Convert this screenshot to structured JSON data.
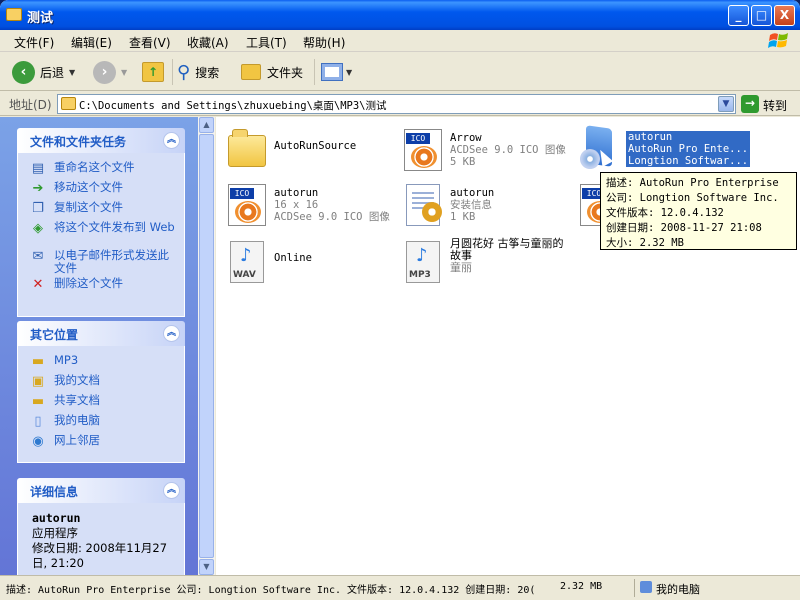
{
  "window": {
    "title": "测试"
  },
  "title_buttons": {
    "minimize": "_",
    "maximize": "□",
    "close": "X"
  },
  "menu": [
    "文件(F)",
    "编辑(E)",
    "查看(V)",
    "收藏(A)",
    "工具(T)",
    "帮助(H)"
  ],
  "toolbar": {
    "back": "后退",
    "search": "搜索",
    "folders": "文件夹"
  },
  "address": {
    "label": "地址(D)",
    "path": "C:\\Documents and Settings\\zhuxuebing\\桌面\\MP3\\测试",
    "go": "转到"
  },
  "left_panels": {
    "tasks": {
      "title": "文件和文件夹任务",
      "items": [
        "重命名这个文件",
        "移动这个文件",
        "复制这个文件",
        "将这个文件发布到 Web",
        "以电子邮件形式发送此文件",
        "删除这个文件"
      ]
    },
    "other_places": {
      "title": "其它位置",
      "items": [
        "MP3",
        "我的文档",
        "共享文档",
        "我的电脑",
        "网上邻居"
      ]
    },
    "details": {
      "title": "详细信息",
      "name": "autorun",
      "type": "应用程序",
      "modified": "修改日期: 2008年11月27日, 21:20"
    }
  },
  "files": [
    {
      "name": "AutoRunSource",
      "line2": "",
      "line3": "",
      "icon": "folder-icon"
    },
    {
      "name": "Arrow",
      "line2": "ACDSee 9.0 ICO 图像",
      "line3": "5 KB",
      "icon": "ico-file-icon"
    },
    {
      "name": "autorun",
      "line2": "AutoRun Pro Ente...",
      "line3": "Longtion Softwar...",
      "icon": "application-icon"
    },
    {
      "name": "autorun",
      "line2": "16 x 16",
      "line3": "ACDSee 9.0 ICO 图像",
      "icon": "ico-file-icon"
    },
    {
      "name": "autorun",
      "line2": "安装信息",
      "line3": "1 KB",
      "icon": "setup-info-icon"
    },
    {
      "name": "Online",
      "line2": "",
      "line3": "",
      "icon": "wav-file-icon"
    },
    {
      "name": "月圆花好 古筝与童丽的故事",
      "line2": "童丽",
      "line3": "",
      "icon": "mp3-file-icon"
    }
  ],
  "tooltip": {
    "desc": "描述: AutoRun Pro Enterprise",
    "company": "公司: Longtion Software Inc.",
    "version": "文件版本: 12.0.4.132",
    "created": "创建日期: 2008-11-27 21:08",
    "size": "大小: 2.32 MB"
  },
  "status": {
    "description": "描述: AutoRun Pro Enterprise 公司: Longtion Software Inc. 文件版本: 12.0.4.132 创建日期: 20(",
    "size": "2.32 MB",
    "location": "我的电脑"
  },
  "colors": {
    "titlebar": "#0058ee",
    "taskpane": "#6375d6",
    "panel_text": "#215dc6",
    "selection": "#316ac5"
  }
}
